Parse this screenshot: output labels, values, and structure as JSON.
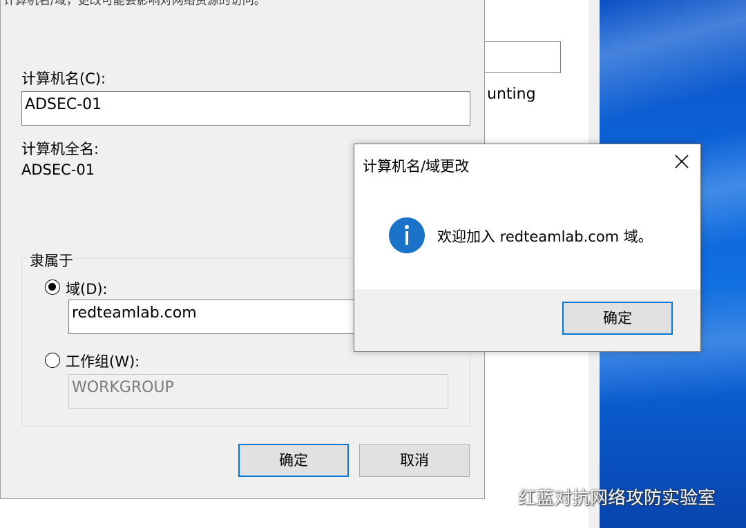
{
  "background": {
    "partial_text": "unting"
  },
  "main_dialog": {
    "cut_off_text": "计算机名/域，更改可能会影响对网络资源的访问。",
    "computer_name_label": "计算机名(C):",
    "computer_name_value": "ADSEC-01",
    "full_name_label": "计算机全名:",
    "full_name_value": "ADSEC-01",
    "member_of_label": "隶属于",
    "domain_label": "域(D):",
    "domain_value": "redteamlab.com",
    "workgroup_label": "工作组(W):",
    "workgroup_value": "WORKGROUP",
    "ok_label": "确定",
    "cancel_label": "取消",
    "selected_option": "domain"
  },
  "message_box": {
    "title": "计算机名/域更改",
    "icon": "info-icon",
    "message": "欢迎加入 redteamlab.com 域。",
    "ok_label": "确定"
  },
  "watermark": {
    "text": "红蓝对抗网络攻防实验室",
    "icon": "wechat-icon"
  },
  "colors": {
    "accent": "#0078d7",
    "info_icon": "#1a73c8",
    "dialog_bg": "#f0f0f0"
  }
}
